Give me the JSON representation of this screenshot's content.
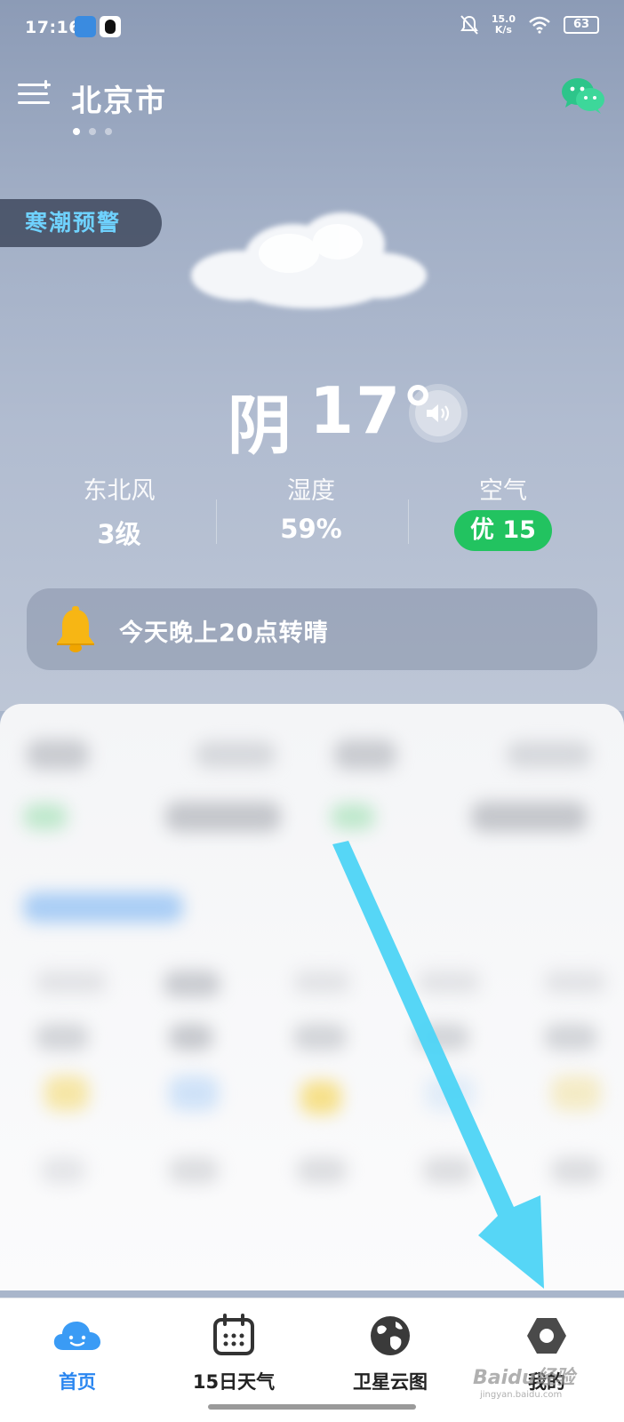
{
  "status_bar": {
    "time": "17:16",
    "net_speed_value": "15.0",
    "net_speed_unit": "K/s",
    "battery": "63",
    "icons": [
      "weather-app-icon",
      "qq-icon",
      "mute-icon",
      "wifi-icon",
      "battery-icon"
    ]
  },
  "header": {
    "city": "北京市",
    "menu_icon": "add-city-menu-icon",
    "share_icon": "wechat-icon",
    "page_count": 3,
    "active_page": 1
  },
  "warning": {
    "label": "寒潮预警"
  },
  "current": {
    "condition": "阴",
    "temperature": "17°",
    "speaker_icon": "speaker-icon"
  },
  "stats": {
    "wind": {
      "label": "东北风",
      "value": "3级"
    },
    "humidity": {
      "label": "湿度",
      "value": "59%"
    },
    "air": {
      "label": "空气",
      "value": "优 15"
    }
  },
  "notice": {
    "text": "今天晚上20点转晴",
    "icon": "bell-icon"
  },
  "bottom_nav": {
    "items": [
      {
        "label": "首页",
        "icon": "cloud-face-icon",
        "active": true
      },
      {
        "label": "15日天气",
        "icon": "calendar-icon",
        "active": false
      },
      {
        "label": "卫星云图",
        "icon": "globe-icon",
        "active": false
      },
      {
        "label": "我的",
        "icon": "settings-hexagon-icon",
        "active": false
      }
    ]
  },
  "watermark": {
    "brand": "Baidu经验",
    "url": "jingyan.baidu.com"
  },
  "colors": {
    "accent_blue": "#2a86f0",
    "warning_text": "#6fd2ff",
    "aqi_green": "#22c360",
    "annotation_arrow": "#4dd4f5"
  }
}
